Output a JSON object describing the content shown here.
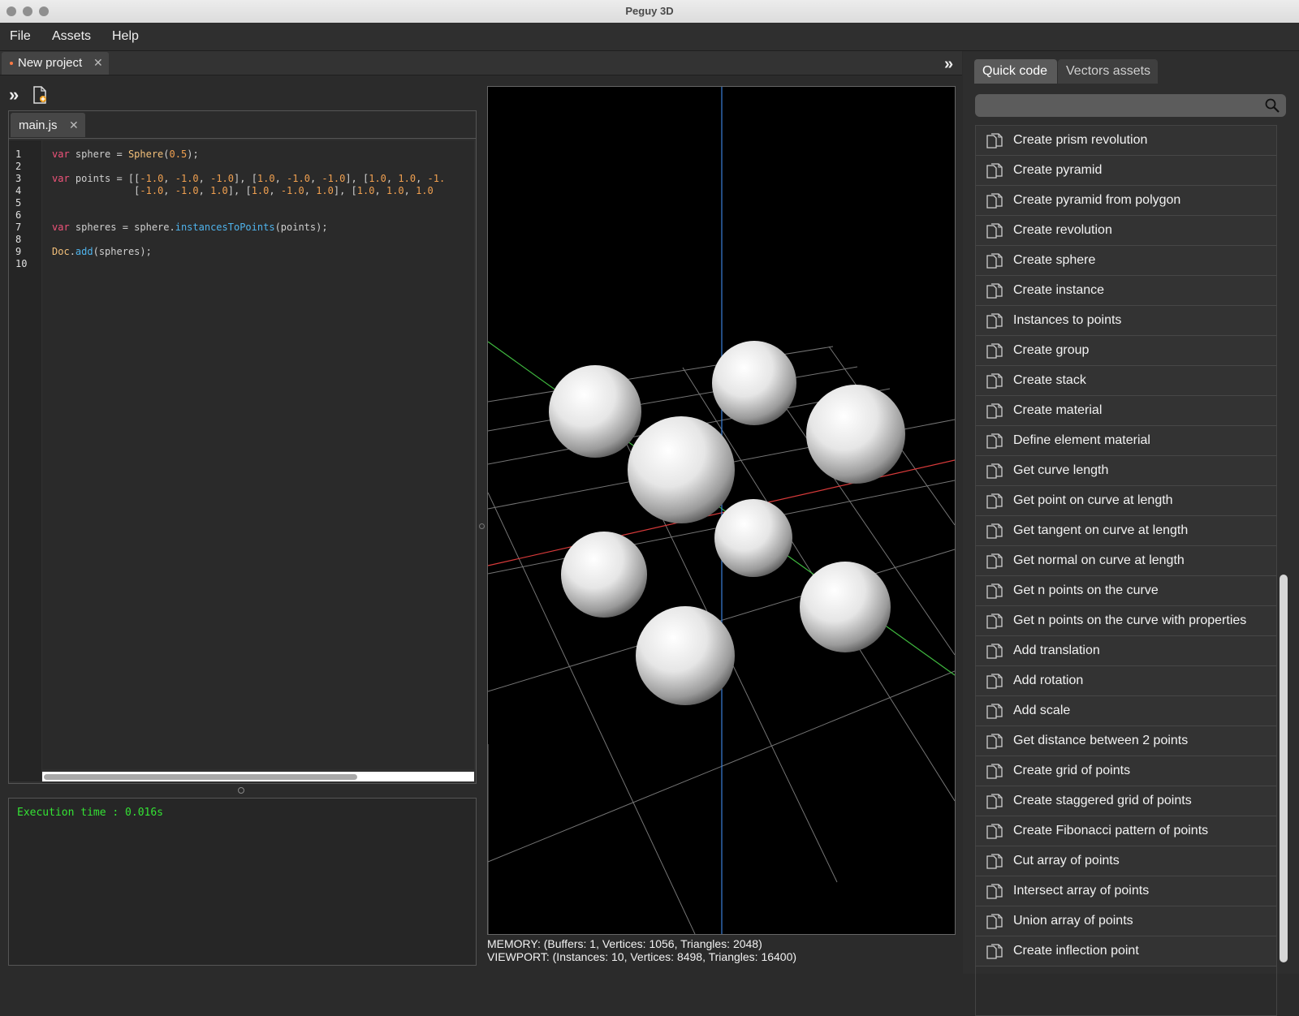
{
  "window": {
    "title": "Peguy 3D"
  },
  "menu": [
    "File",
    "Assets",
    "Help"
  ],
  "project_tab": {
    "label": "New project",
    "close": "✕"
  },
  "editor": {
    "tab_label": "main.js",
    "tab_close": "✕",
    "line_numbers": [
      "1",
      "2",
      "3",
      "4",
      "5",
      "6",
      "7",
      "8",
      "9",
      "10"
    ],
    "code_lines": [
      "var sphere = Sphere(0.5);",
      "",
      "var points = [[-1.0, -1.0, -1.0], [1.0, -1.0, -1.0], [1.0, 1.0, -1.",
      "              [-1.0, -1.0, 1.0], [1.0, -1.0, 1.0], [1.0, 1.0, 1.0",
      "",
      "",
      "var spheres = sphere.instancesToPoints(points);",
      "",
      "Doc.add(spheres);",
      ""
    ]
  },
  "console": {
    "text": "Execution time : 0.016s"
  },
  "status": {
    "memory": "MEMORY: (Buffers: 1, Vertices: 1056, Triangles: 2048)",
    "viewport": "VIEWPORT: (Instances: 10, Vertices: 8498, Triangles: 16400)"
  },
  "right_panel": {
    "tabs": [
      "Quick code",
      "Vectors assets"
    ],
    "active_tab": "Quick code",
    "search": {
      "value": "",
      "placeholder": ""
    },
    "items": [
      "Create prism revolution",
      "Create pyramid",
      "Create pyramid from polygon",
      "Create revolution",
      "Create sphere",
      "Create instance",
      "Instances to points",
      "Create group",
      "Create stack",
      "Create material",
      "Define element material",
      "Get curve length",
      "Get point on curve at length",
      "Get tangent on curve at length",
      "Get normal on curve at length",
      "Get n points on the curve",
      "Get n points on the curve with properties",
      "Add translation",
      "Add rotation",
      "Add scale",
      "Get distance between 2 points",
      "Create grid of points",
      "Create staggered grid of points",
      "Create Fibonacci pattern of points",
      "Cut array of points",
      "Intersect array of points",
      "Union array of points",
      "Create inflection point"
    ]
  },
  "colors": {
    "x_axis": "#d83a3a",
    "y_axis": "#3fb83f",
    "z_axis": "#3a7fd8",
    "console_text": "#34e334",
    "unsaved_dot": "#ff7a45"
  },
  "icons": [
    "run-icon",
    "new-file-icon",
    "collapse-panel-icon",
    "search-icon",
    "snippet-icon",
    "close-icon"
  ]
}
